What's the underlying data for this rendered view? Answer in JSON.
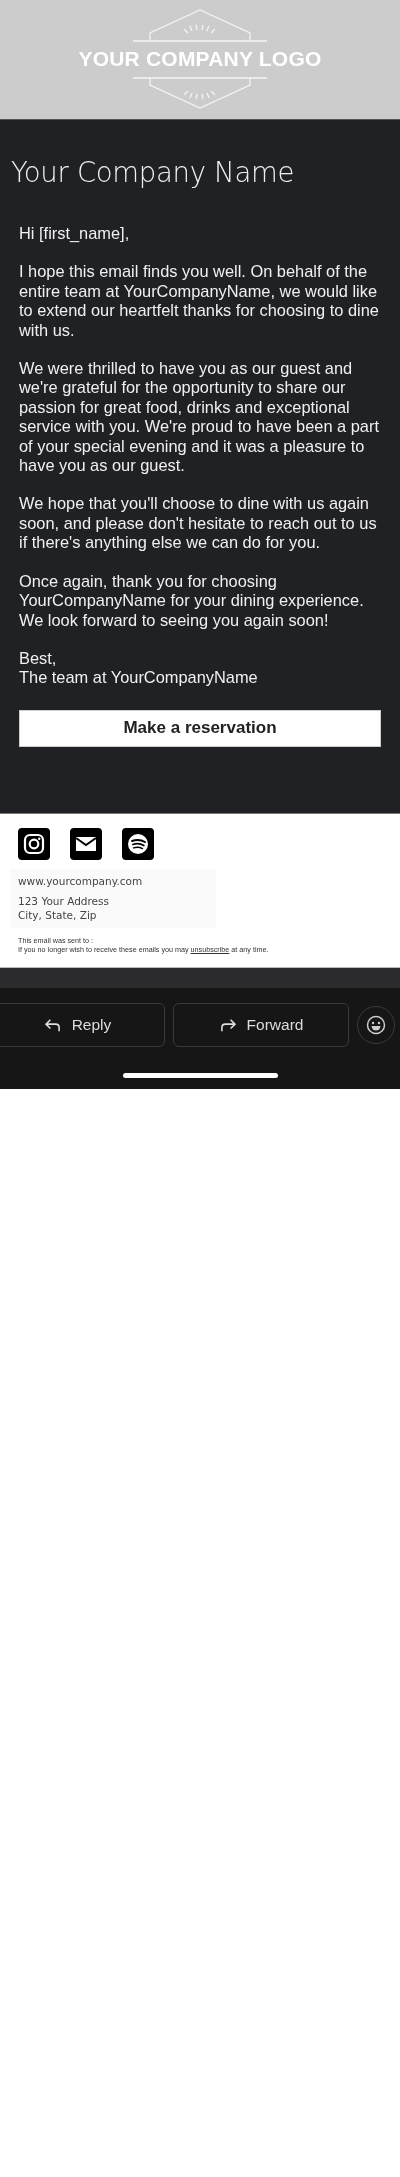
{
  "header": {
    "logo_text": "YOUR COMPANY LOGO"
  },
  "email": {
    "company_name": "Your Company Name",
    "paragraphs": [
      "Hi [first_name],",
      "I hope this email finds you well. On behalf of the entire team at YourCompanyName, we would like to extend our heartfelt thanks for choosing to dine with us.",
      "We were thrilled to have you as our guest and we're grateful for the opportunity to share our passion for great food, drinks and exceptional service with you. We're proud to have been a part of your special evening and it was a pleasure to have you as our guest.",
      "We hope that you'll choose to dine with us again soon, and please don't hesitate to reach out to us if there's anything else we can do for you.",
      "Once again, thank you for choosing YourCompanyName for your dining experience. We look forward to seeing you again soon!"
    ],
    "signoff": [
      "Best,",
      "The team at YourCompanyName"
    ],
    "cta_button": "Make a reservation"
  },
  "footer": {
    "social": [
      {
        "kind": "instagram"
      },
      {
        "kind": "mail"
      },
      {
        "kind": "spotify"
      }
    ],
    "website": "www.yourcompany.com",
    "address": [
      "123 Your Address",
      "City, State, Zip"
    ],
    "sent_to": "This email was sent to :",
    "unsubscribe": {
      "before": "If you no longer wish to receive these emails you may",
      "link": "unsubscribe",
      "after": "at any time."
    }
  },
  "actions": [
    {
      "kind": "reply",
      "label": "Reply"
    },
    {
      "kind": "forward",
      "label": "Forward"
    }
  ]
}
